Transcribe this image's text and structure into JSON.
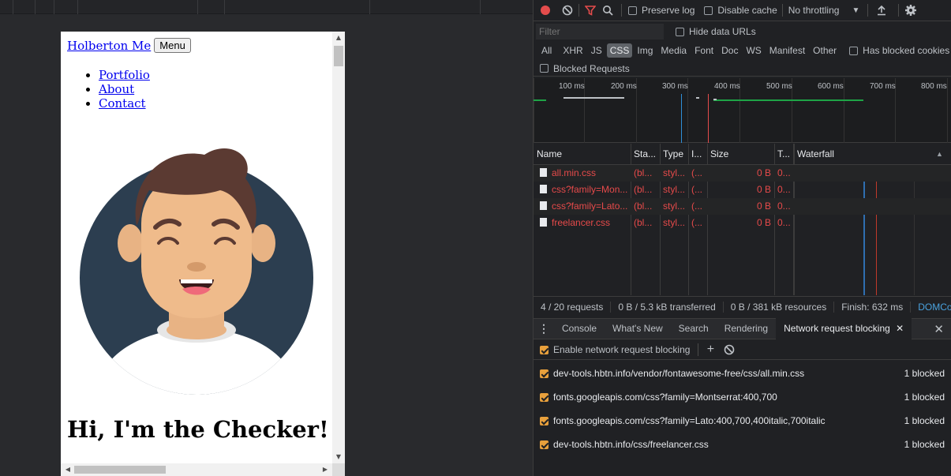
{
  "page": {
    "brand": "Holberton Me",
    "menu_button": "Menu",
    "nav": [
      "Portfolio",
      "About",
      "Contact"
    ],
    "hero_title": "Hi, I'm the Checker!"
  },
  "devtools": {
    "toolbar": {
      "preserve_log": "Preserve log",
      "disable_cache": "Disable cache",
      "throttling": "No throttling"
    },
    "filter": {
      "placeholder": "Filter",
      "hide_data_urls": "Hide data URLs"
    },
    "types": [
      "All",
      "XHR",
      "JS",
      "CSS",
      "Img",
      "Media",
      "Font",
      "Doc",
      "WS",
      "Manifest",
      "Other"
    ],
    "active_type": "CSS",
    "has_blocked_cookies": "Has blocked cookies",
    "blocked_requests": "Blocked Requests",
    "overview_ticks": [
      "100 ms",
      "200 ms",
      "300 ms",
      "400 ms",
      "500 ms",
      "600 ms",
      "700 ms",
      "800 ms"
    ],
    "table": {
      "headers": [
        "Name",
        "Sta...",
        "Type",
        "I...",
        "Size",
        "T...",
        "Waterfall"
      ],
      "rows": [
        {
          "name": "all.min.css",
          "status": "(bl...",
          "type": "styl...",
          "initiator": "(...",
          "size": "0 B",
          "time": "0..."
        },
        {
          "name": "css?family=Mon...",
          "status": "(bl...",
          "type": "styl...",
          "initiator": "(...",
          "size": "0 B",
          "time": "0..."
        },
        {
          "name": "css?family=Lato...",
          "status": "(bl...",
          "type": "styl...",
          "initiator": "(...",
          "size": "0 B",
          "time": "0..."
        },
        {
          "name": "freelancer.css",
          "status": "(bl...",
          "type": "styl...",
          "initiator": "(...",
          "size": "0 B",
          "time": "0..."
        }
      ]
    },
    "status": {
      "requests": "4 / 20 requests",
      "transferred": "0 B / 5.3 kB transferred",
      "resources": "0 B / 381 kB resources",
      "finish": "Finish: 632 ms",
      "domcontent": "DOMCon"
    },
    "drawer_tabs": [
      "Console",
      "What's New",
      "Search",
      "Rendering",
      "Network request blocking"
    ],
    "enable_blocking": "Enable network request blocking",
    "blocked_patterns": [
      {
        "pattern": "dev-tools.hbtn.info/vendor/fontawesome-free/css/all.min.css",
        "count": "1 blocked"
      },
      {
        "pattern": "fonts.googleapis.com/css?family=Montserrat:400,700",
        "count": "1 blocked"
      },
      {
        "pattern": "fonts.googleapis.com/css?family=Lato:400,700,400italic,700italic",
        "count": "1 blocked"
      },
      {
        "pattern": "dev-tools.hbtn.info/css/freelancer.css",
        "count": "1 blocked"
      }
    ],
    "colors": {
      "record": "#e44c4c",
      "filter_active": "#e44c4c",
      "blocked_text": "#e64a4a",
      "checkbox": "#e8a03c",
      "link_blue": "#4aa3df"
    }
  }
}
